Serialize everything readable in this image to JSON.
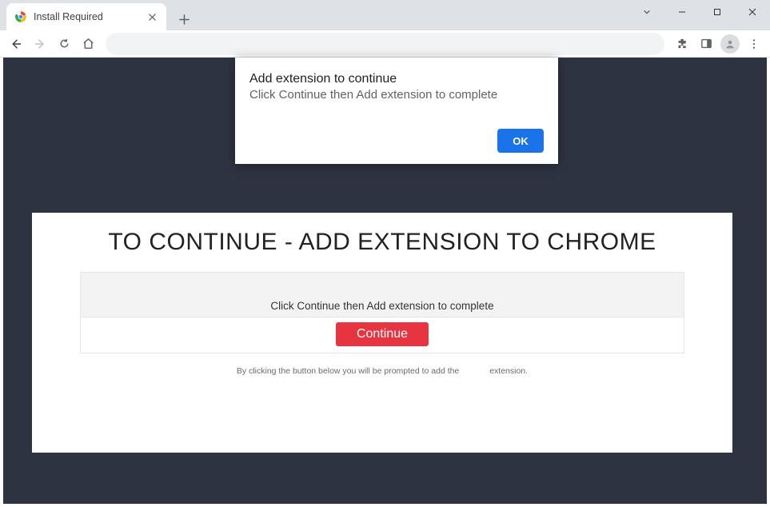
{
  "tab": {
    "title": "Install Required"
  },
  "dialog": {
    "title": "Add extension to continue",
    "message": "Click Continue then Add extension to complete",
    "ok_label": "OK"
  },
  "page": {
    "heading": "TO CONTINUE - ADD EXTENSION TO CHROME",
    "subheading": "Click Continue then Add extension to complete",
    "continue_label": "Continue",
    "disclaimer_left": "By clicking the button below you will be prompted to add the",
    "disclaimer_right": "extension."
  }
}
